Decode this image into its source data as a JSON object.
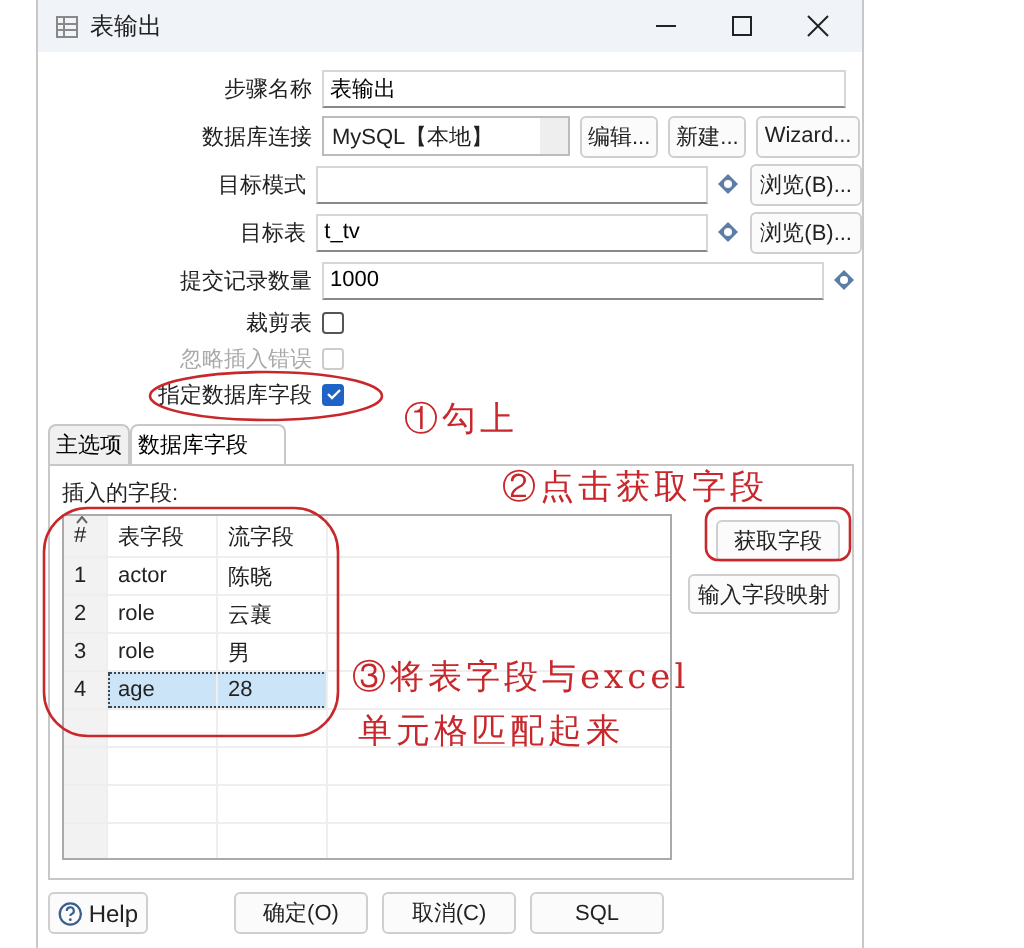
{
  "window": {
    "title": "表输出"
  },
  "form": {
    "step_name": {
      "label": "步骤名称",
      "value": "表输出"
    },
    "connection": {
      "label": "数据库连接",
      "value": "MySQL【本地】",
      "buttons": [
        "编辑...",
        "新建...",
        "Wizard..."
      ]
    },
    "target_schema": {
      "label": "目标模式",
      "button": "浏览(B)..."
    },
    "target_table": {
      "label": "目标表",
      "value": "t_tv",
      "button": "浏览(B)..."
    },
    "commit_size": {
      "label": "提交记录数量",
      "value": "1000"
    },
    "checkboxes": [
      {
        "label": "裁剪表",
        "checked": false,
        "disabled": false
      },
      {
        "label": "忽略插入错误",
        "checked": false,
        "disabled": true
      },
      {
        "label": "指定数据库字段",
        "checked": true,
        "disabled": false
      }
    ]
  },
  "tabs": [
    {
      "label": "主选项",
      "selected": false
    },
    {
      "label": "数据库字段",
      "selected": true
    }
  ],
  "fields_panel": {
    "title": "插入的字段:",
    "columns": [
      "#",
      "表字段",
      "流字段"
    ],
    "rows": [
      {
        "cells": [
          "1",
          "actor",
          "陈晓"
        ],
        "selected": false
      },
      {
        "cells": [
          "2",
          "role",
          "云襄"
        ],
        "selected": false
      },
      {
        "cells": [
          "3",
          "role",
          "男"
        ],
        "selected": false
      },
      {
        "cells": [
          "4",
          "age",
          "28"
        ],
        "selected": true
      }
    ],
    "buttons": [
      "获取字段",
      "输入字段映射"
    ]
  },
  "bottom_buttons": [
    {
      "label": "Help",
      "kind": "help"
    },
    {
      "label": "确定(O)",
      "kind": "plain"
    },
    {
      "label": "取消(C)",
      "kind": "plain"
    },
    {
      "label": "SQL",
      "kind": "plain"
    }
  ],
  "annotations": [
    {
      "text": "①勾上"
    },
    {
      "text": "②点击获取字段"
    },
    {
      "text": "③将表字段与excel"
    },
    {
      "text": "单元格匹配起来"
    }
  ]
}
